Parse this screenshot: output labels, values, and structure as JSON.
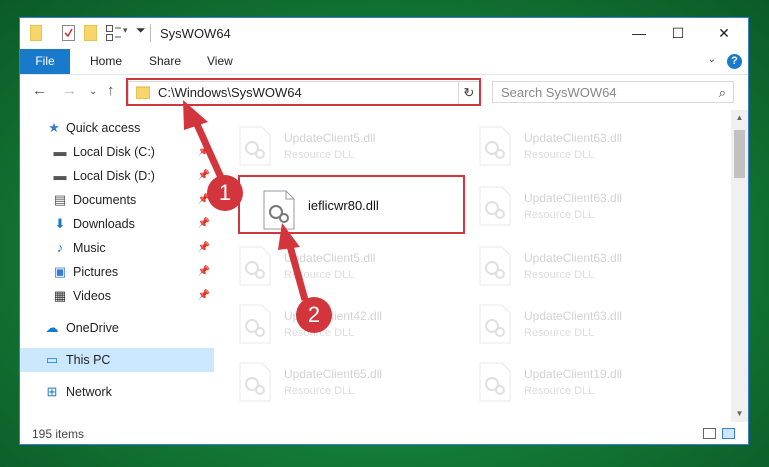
{
  "window": {
    "title": "SysWOW64"
  },
  "ribbon": {
    "tabs": [
      "File",
      "Home",
      "Share",
      "View"
    ]
  },
  "nav": {
    "address": "C:\\Windows\\SysWOW64",
    "search_placeholder": "Search SysWOW64"
  },
  "sidebar": {
    "items": [
      {
        "label": "Quick access",
        "icon": "star-icon",
        "pinned": false
      },
      {
        "label": "Local Disk (C:)",
        "icon": "drive-icon",
        "pinned": true
      },
      {
        "label": "Local Disk (D:)",
        "icon": "drive-icon",
        "pinned": true
      },
      {
        "label": "Documents",
        "icon": "documents-icon",
        "pinned": true
      },
      {
        "label": "Downloads",
        "icon": "download-icon",
        "pinned": true
      },
      {
        "label": "Music",
        "icon": "music-icon",
        "pinned": true
      },
      {
        "label": "Pictures",
        "icon": "pictures-icon",
        "pinned": true
      },
      {
        "label": "Videos",
        "icon": "videos-icon",
        "pinned": true
      },
      {
        "label": "OneDrive",
        "icon": "cloud-icon",
        "pinned": false
      },
      {
        "label": "This PC",
        "icon": "computer-icon",
        "pinned": false,
        "selected": true
      },
      {
        "label": "Network",
        "icon": "network-icon",
        "pinned": false
      }
    ]
  },
  "files": {
    "highlighted": {
      "name": "ieflicwr80.dll"
    },
    "faded": [
      {
        "name": "UpdateClient5.dll",
        "type": "Resource DLL"
      },
      {
        "name": "UpdateClient63.dll",
        "type": "Resource DLL"
      },
      {
        "name": "UpdateClient63.dll",
        "type": "Resource DLL"
      },
      {
        "name": "UpdateClient5.dll",
        "type": "Resource DLL"
      },
      {
        "name": "UpdateClient63.dll",
        "type": "Resource DLL"
      },
      {
        "name": "UpdateClient42.dll",
        "type": "Resource DLL"
      },
      {
        "name": "UpdateClient63.dll",
        "type": "Resource DLL"
      },
      {
        "name": "UpdateClient65.dll",
        "type": "Resource DLL"
      },
      {
        "name": "UpdateClient19.dll",
        "type": "Resource DLL"
      }
    ]
  },
  "status": {
    "item_count": "195 items"
  },
  "annotations": {
    "step1": "1",
    "step2": "2",
    "color": "#d3353d"
  }
}
